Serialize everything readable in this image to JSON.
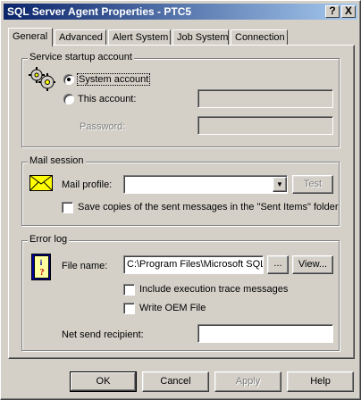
{
  "window": {
    "title": "SQL Server Agent Properties - PTC5",
    "close_label": "X",
    "help_label": "?"
  },
  "tabs": [
    {
      "label": "General",
      "active": true
    },
    {
      "label": "Advanced",
      "active": false
    },
    {
      "label": "Alert System",
      "active": false
    },
    {
      "label": "Job System",
      "active": false
    },
    {
      "label": "Connection",
      "active": false
    }
  ],
  "service_startup": {
    "group_title": "Service startup account",
    "system_account_label": "System account",
    "this_account_label": "This account:",
    "this_account_value": "",
    "password_label": "Password:",
    "password_value": "",
    "selected": "system_account"
  },
  "mail_session": {
    "group_title": "Mail session",
    "mail_profile_label": "Mail profile:",
    "mail_profile_value": "",
    "test_label": "Test",
    "save_copies_label": "Save copies of the sent messages in the \"Sent Items\" folder",
    "save_copies_checked": false
  },
  "error_log": {
    "group_title": "Error log",
    "file_name_label": "File name:",
    "file_name_value": "C:\\Program Files\\Microsoft SQL",
    "browse_label": "...",
    "view_label": "View...",
    "include_trace_label": "Include execution trace messages",
    "include_trace_checked": false,
    "write_oem_label": "Write OEM File",
    "write_oem_checked": false,
    "net_send_label": "Net send recipient:",
    "net_send_value": ""
  },
  "footer": {
    "ok_label": "OK",
    "cancel_label": "Cancel",
    "apply_label": "Apply",
    "help_label": "Help"
  },
  "colors": {
    "face": "#d4d0c8",
    "title_start": "#0a246a",
    "title_end": "#a6caf0",
    "mail_icon": "#ffff00"
  }
}
